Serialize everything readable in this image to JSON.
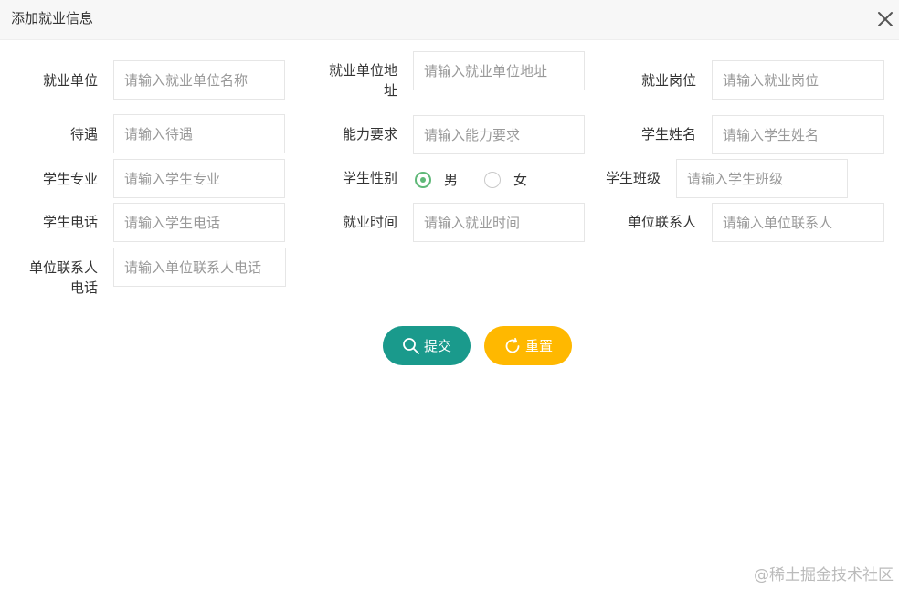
{
  "dialog": {
    "title": "添加就业信息",
    "close_icon": "close-icon"
  },
  "form": {
    "employer": {
      "label": "就业单位",
      "placeholder": "请输入就业单位名称",
      "value": ""
    },
    "employer_address": {
      "label_line1": "就业单位地",
      "label_line2": "址",
      "placeholder": "请输入就业单位地址",
      "value": ""
    },
    "position": {
      "label": "就业岗位",
      "placeholder": "请输入就业岗位",
      "value": ""
    },
    "salary": {
      "label": "待遇",
      "placeholder": "请输入待遇",
      "value": ""
    },
    "requirements": {
      "label": "能力要求",
      "placeholder": "请输入能力要求",
      "value": ""
    },
    "student_name": {
      "label": "学生姓名",
      "placeholder": "请输入学生姓名",
      "value": ""
    },
    "student_major": {
      "label": "学生专业",
      "placeholder": "请输入学生专业",
      "value": ""
    },
    "student_gender": {
      "label": "学生性别",
      "options": [
        "男",
        "女"
      ],
      "selected": "男"
    },
    "student_class": {
      "label": "学生班级",
      "placeholder": "请输入学生班级",
      "value": ""
    },
    "student_phone": {
      "label": "学生电话",
      "placeholder": "请输入学生电话",
      "value": ""
    },
    "employment_time": {
      "label": "就业时间",
      "placeholder": "请输入就业时间",
      "value": ""
    },
    "contact_person": {
      "label": "单位联系人",
      "placeholder": "请输入单位联系人",
      "value": ""
    },
    "contact_phone": {
      "label_line1": "单位联系人",
      "label_line2": "电话",
      "placeholder": "请输入单位联系人电话",
      "value": ""
    }
  },
  "buttons": {
    "submit_label": "提交",
    "submit_icon": "search-icon",
    "reset_label": "重置",
    "reset_icon": "refresh-icon"
  },
  "watermark": "@稀土掘金技术社区",
  "colors": {
    "submit": "#1a9a8c",
    "reset": "#ffb800",
    "radio_checked": "#5fb878"
  }
}
